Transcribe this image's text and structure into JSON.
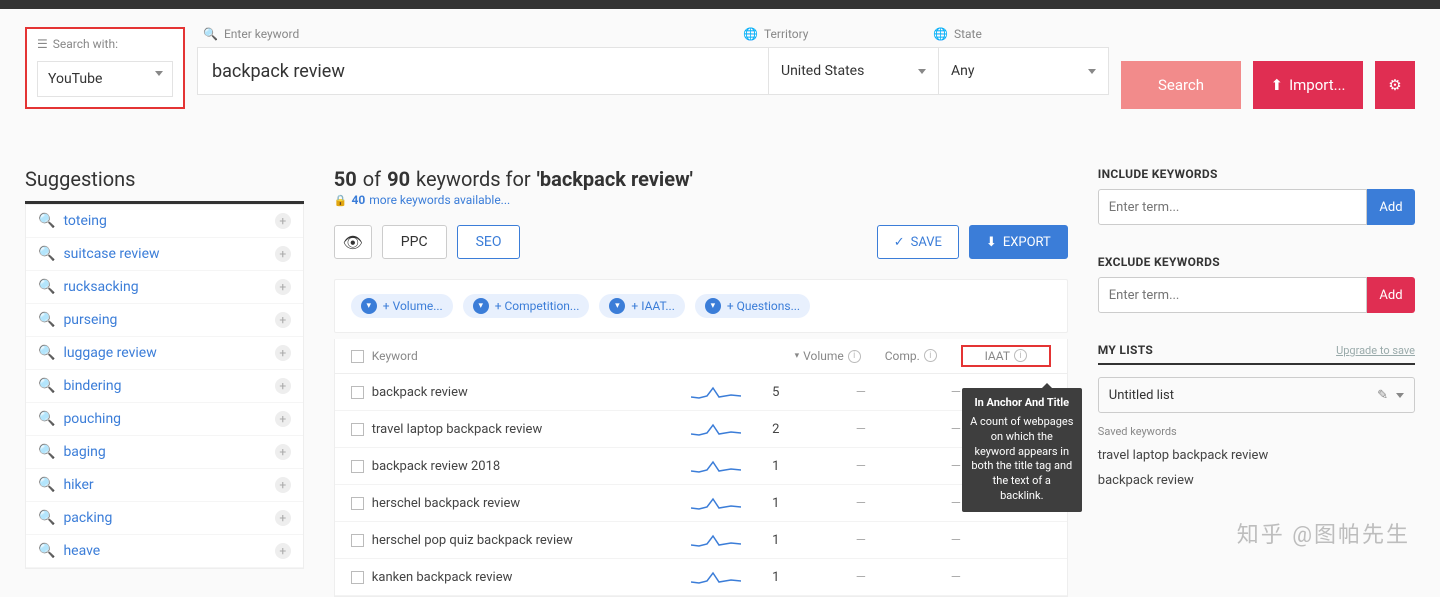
{
  "search": {
    "with_label": "Search with:",
    "with_value": "YouTube",
    "keyword_label": "Enter keyword",
    "keyword_value": "backpack review",
    "territory_label": "Territory",
    "territory_value": "United States",
    "state_label": "State",
    "state_value": "Any",
    "search_btn": "Search",
    "import_btn": "Import..."
  },
  "suggestions": {
    "title": "Suggestions",
    "items": [
      "toteing",
      "suitcase review",
      "rucksacking",
      "purseing",
      "luggage review",
      "bindering",
      "pouching",
      "baging",
      "hiker",
      "packing",
      "heave"
    ]
  },
  "summary": {
    "count_shown": "50",
    "of": "of",
    "count_total": "90",
    "keywords_for": "keywords for",
    "term": "'backpack review'",
    "lock_count": "40",
    "lock_text": "more keywords available..."
  },
  "tabs": {
    "ppc": "PPC",
    "seo": "SEO"
  },
  "actions": {
    "save": "SAVE",
    "export": "EXPORT"
  },
  "chips": [
    "+ Volume...",
    "+ Competition...",
    "+ IAAT...",
    "+ Questions..."
  ],
  "columns": {
    "keyword": "Keyword",
    "volume": "Volume",
    "comp": "Comp.",
    "iaat": "IAAT"
  },
  "rows": [
    {
      "kw": "backpack review",
      "vol": "5",
      "comp": "—",
      "iaat": "—"
    },
    {
      "kw": "travel laptop backpack review",
      "vol": "2",
      "comp": "—",
      "iaat": "—"
    },
    {
      "kw": "backpack review 2018",
      "vol": "1",
      "comp": "—",
      "iaat": "—"
    },
    {
      "kw": "herschel backpack review",
      "vol": "1",
      "comp": "—",
      "iaat": "—"
    },
    {
      "kw": "herschel pop quiz backpack review",
      "vol": "1",
      "comp": "—",
      "iaat": "—"
    },
    {
      "kw": "kanken backpack review",
      "vol": "1",
      "comp": "—",
      "iaat": "—"
    }
  ],
  "tooltip": {
    "title": "In Anchor And Title",
    "body": "A count of webpages on which the keyword appears in both the title tag and the text of a backlink."
  },
  "filters": {
    "include_title": "INCLUDE KEYWORDS",
    "exclude_title": "EXCLUDE KEYWORDS",
    "placeholder": "Enter term...",
    "add": "Add"
  },
  "lists": {
    "title": "MY LISTS",
    "upgrade": "Upgrade to save",
    "selected": "Untitled list",
    "saved_label": "Saved keywords",
    "saved": [
      "travel laptop backpack review",
      "backpack review"
    ]
  },
  "watermark": "知乎 @图帕先生"
}
